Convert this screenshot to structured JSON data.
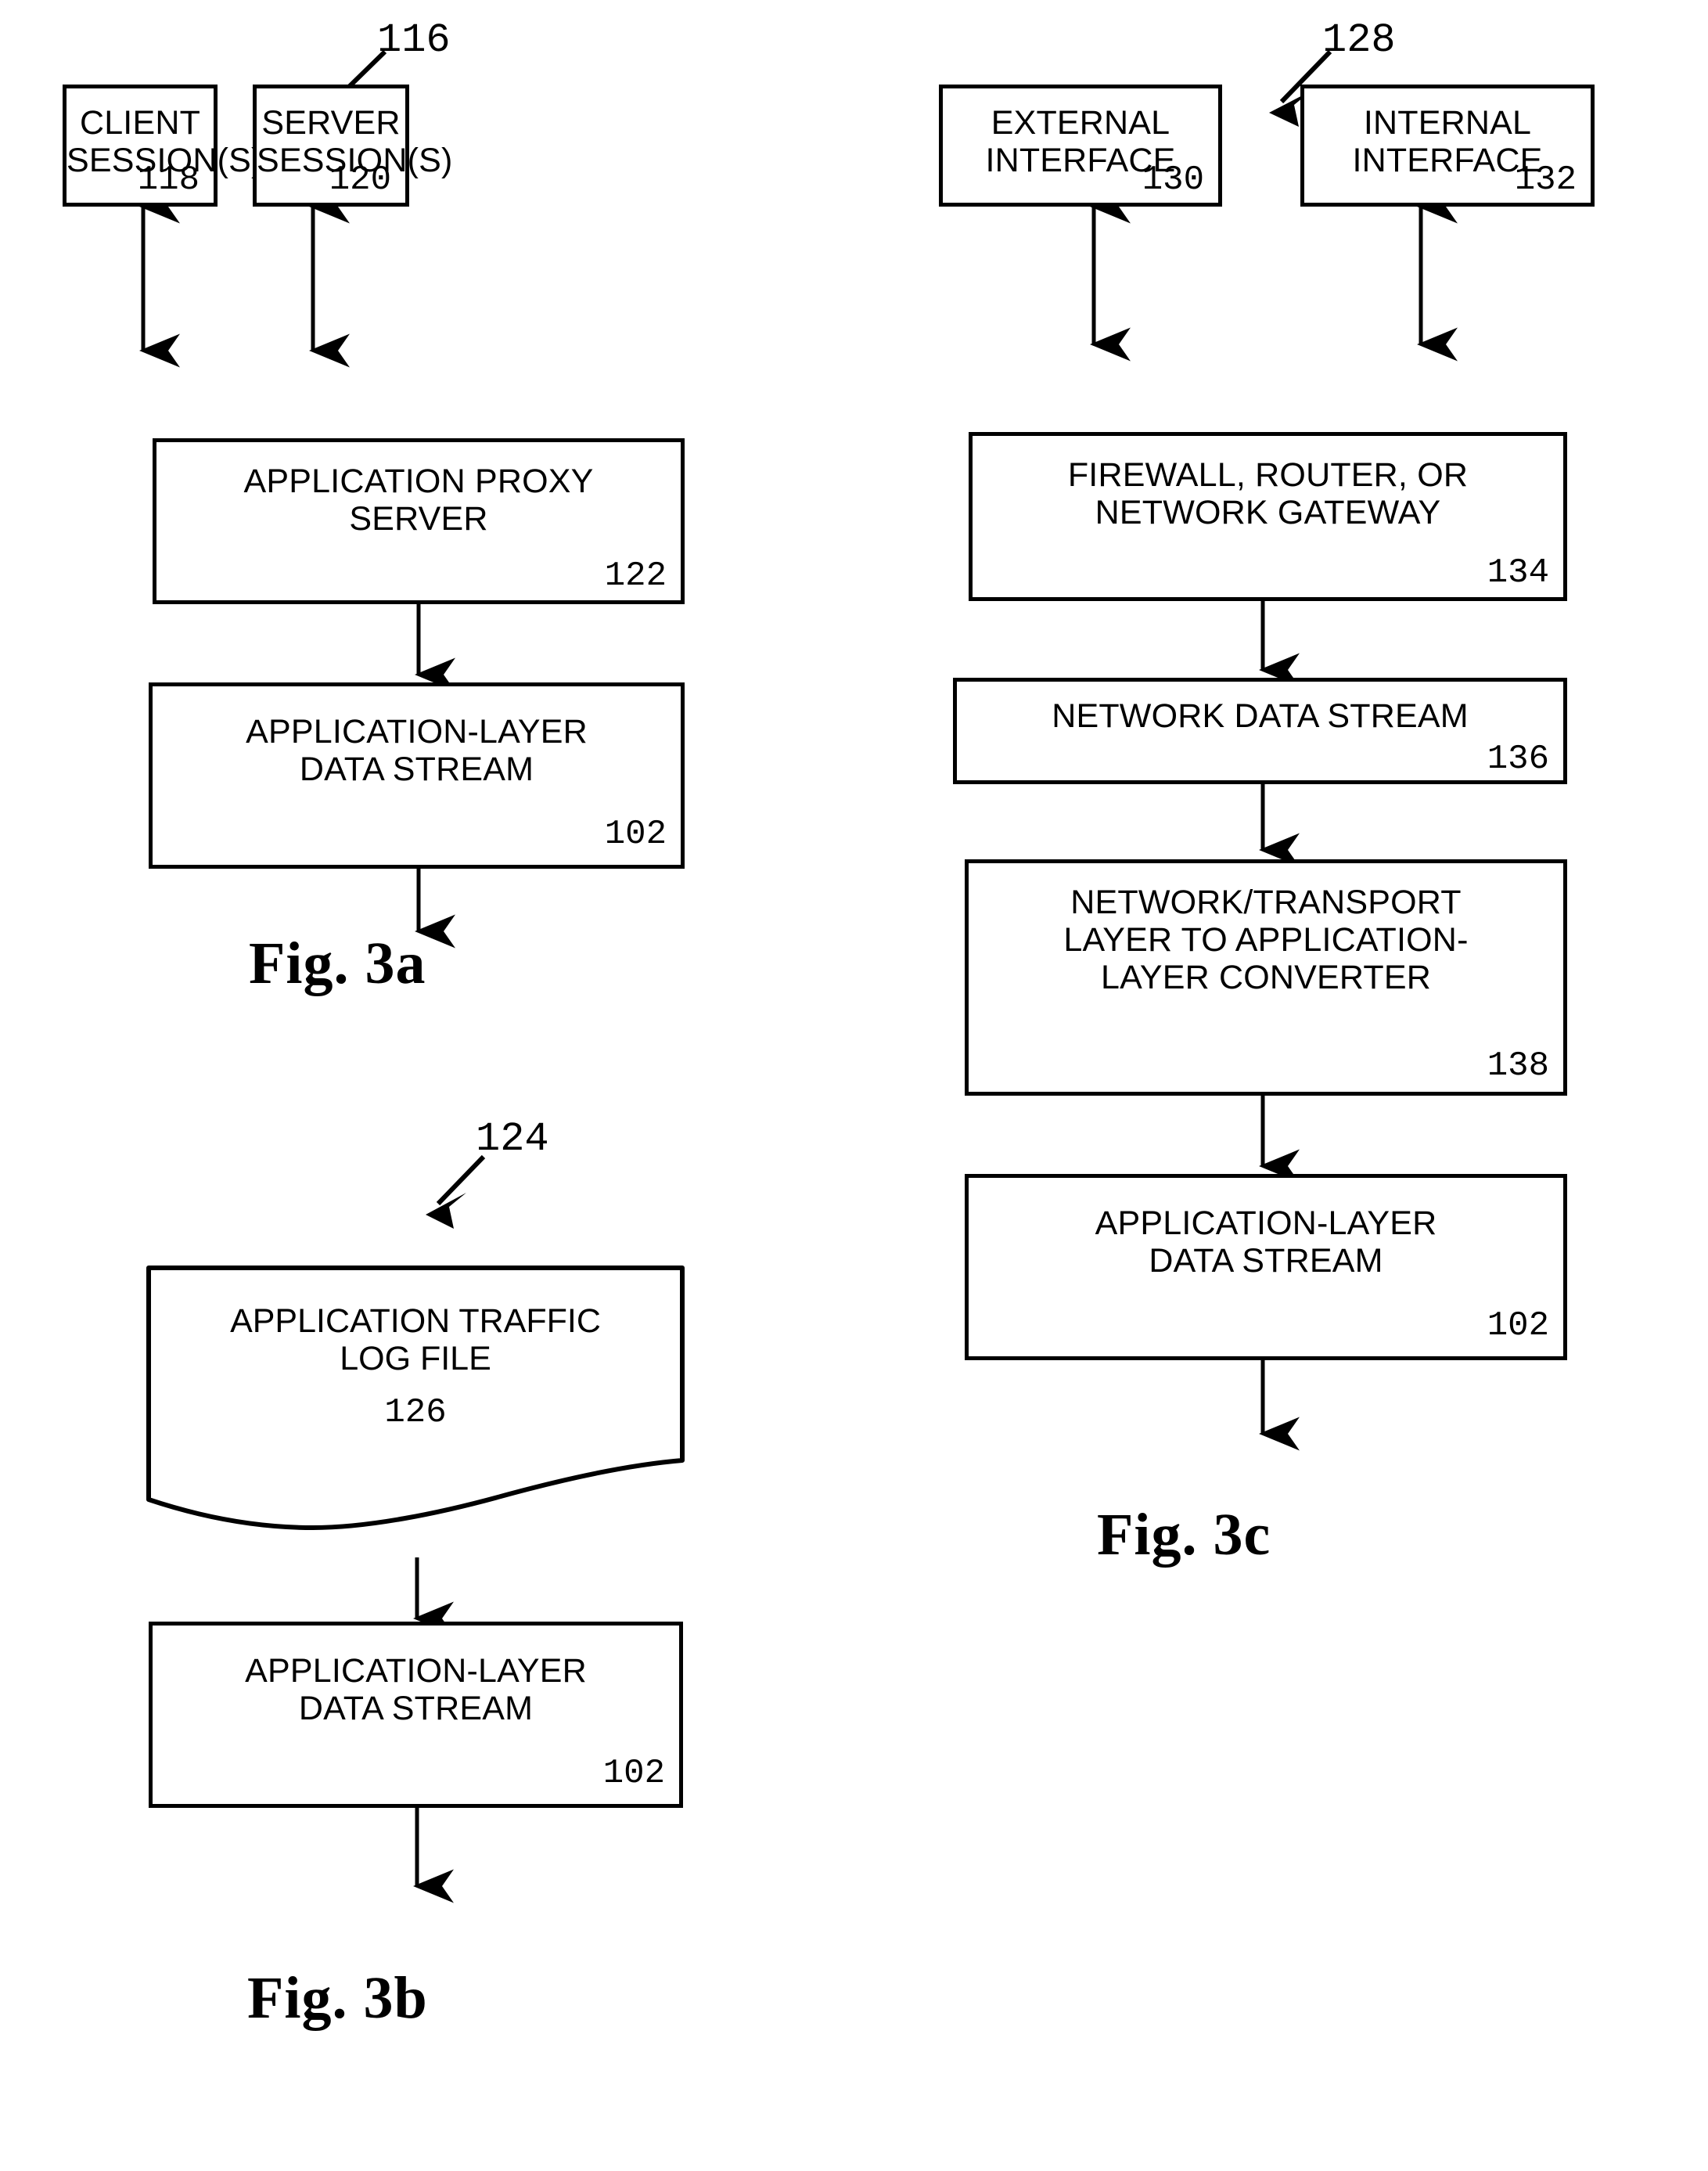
{
  "figures": [
    {
      "id": "fig-3a",
      "caption": "Fig. 3a",
      "callout": "116",
      "nodes": [
        {
          "id": "client-sessions",
          "label": "CLIENT\nSESSION(S)",
          "ref": "118"
        },
        {
          "id": "server-sessions",
          "label": "SERVER\nSESSION(S)",
          "ref": "120"
        },
        {
          "id": "application-proxy-server",
          "label": "APPLICATION PROXY\nSERVER",
          "ref": "122"
        },
        {
          "id": "application-layer-data-stream",
          "label": "APPLICATION-LAYER\nDATA STREAM",
          "ref": "102"
        }
      ]
    },
    {
      "id": "fig-3b",
      "caption": "Fig. 3b",
      "callout": "124",
      "nodes": [
        {
          "id": "application-traffic-log-file",
          "label": "APPLICATION TRAFFIC\nLOG FILE",
          "ref": "126"
        },
        {
          "id": "application-layer-data-stream",
          "label": "APPLICATION-LAYER\nDATA STREAM",
          "ref": "102"
        }
      ]
    },
    {
      "id": "fig-3c",
      "caption": "Fig. 3c",
      "callout": "128",
      "nodes": [
        {
          "id": "external-interface",
          "label": "EXTERNAL\nINTERFACE",
          "ref": "130"
        },
        {
          "id": "internal-interface",
          "label": "INTERNAL\nINTERFACE",
          "ref": "132"
        },
        {
          "id": "firewall-router-gateway",
          "label": "FIREWALL, ROUTER, OR\nNETWORK GATEWAY",
          "ref": "134"
        },
        {
          "id": "network-data-stream",
          "label": "NETWORK DATA STREAM",
          "ref": "136"
        },
        {
          "id": "converter",
          "label": "NETWORK/TRANSPORT\nLAYER TO APPLICATION-\nLAYER CONVERTER",
          "ref": "138"
        },
        {
          "id": "application-layer-data-stream",
          "label": "APPLICATION-LAYER\nDATA STREAM",
          "ref": "102"
        }
      ]
    }
  ],
  "colors": {
    "ink": "#000000",
    "paper": "#ffffff"
  }
}
